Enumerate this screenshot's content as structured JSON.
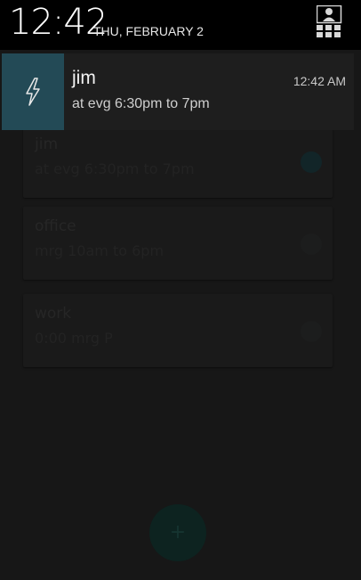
{
  "status": {
    "time": "12:42",
    "date": "THU, FEBRUARY 2"
  },
  "notification": {
    "title": "jim",
    "text": "at evg 6:30pm  to 7pm",
    "time": "12:42 AM",
    "icon": "lightning-icon",
    "accent": "#234a56"
  },
  "app": {
    "cards": [
      {
        "title": "jim",
        "sub": "at evg 6:30pm  to 7pm",
        "toggle_on": true
      },
      {
        "title": "office",
        "sub": "mrg 10am  to 6pm",
        "toggle_on": false
      },
      {
        "title": "work",
        "sub": "0:00 mrg P",
        "toggle_on": false
      }
    ],
    "fab_icon": "plus-icon",
    "fab_label": "+"
  }
}
